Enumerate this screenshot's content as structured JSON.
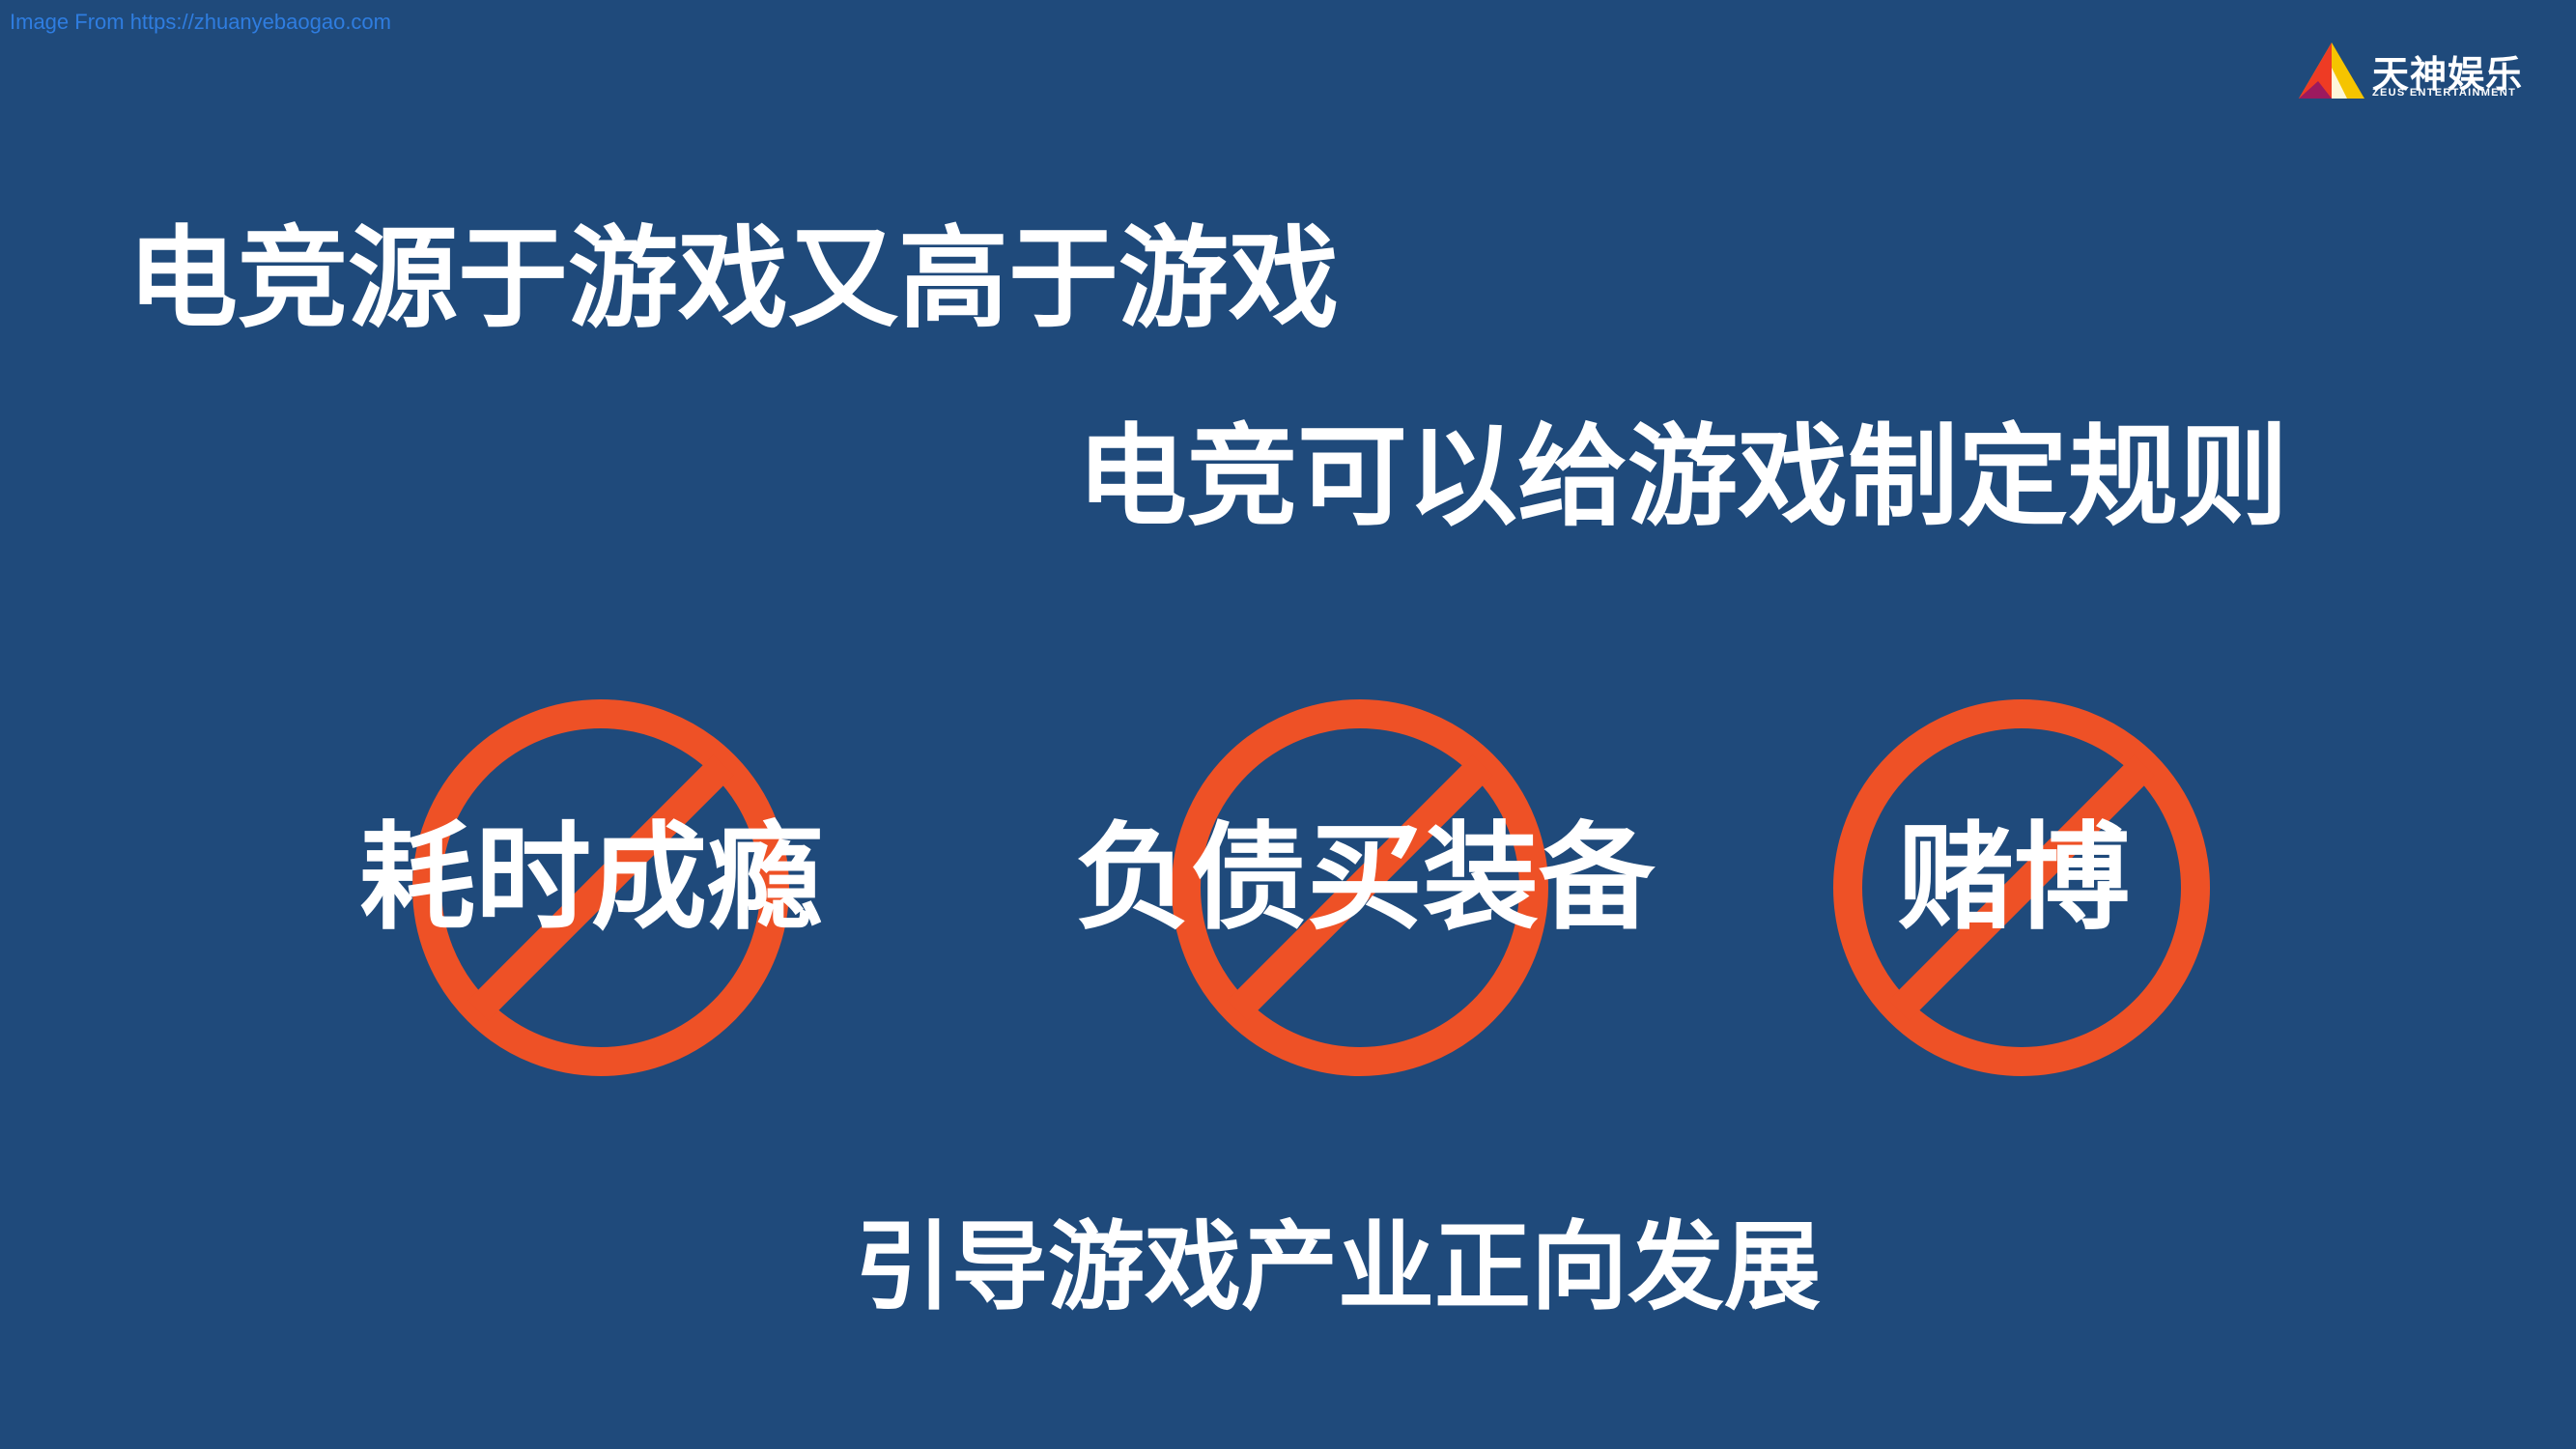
{
  "watermark": {
    "text": "Image From https://zhuanyebaogao.com"
  },
  "logo": {
    "name_cn": "天神娱乐",
    "name_en": "ZEUS ENTERTAINMENT",
    "colors": [
      "#f5c400",
      "#ee3b24",
      "#9c1a5f"
    ]
  },
  "headline_1": "电竞源于游戏又高于游戏",
  "headline_2": "电竞可以给游戏制定规则",
  "prohibited": [
    {
      "label": "耗时成瘾",
      "icon": "prohibition-icon"
    },
    {
      "label": "负债买装备",
      "icon": "prohibition-icon"
    },
    {
      "label": "赌博",
      "icon": "prohibition-icon"
    }
  ],
  "footer": "引导游戏产业正向发展",
  "colors": {
    "background": "#1f4a7b",
    "prohibition": "#ee5126",
    "text": "#ffffff"
  }
}
